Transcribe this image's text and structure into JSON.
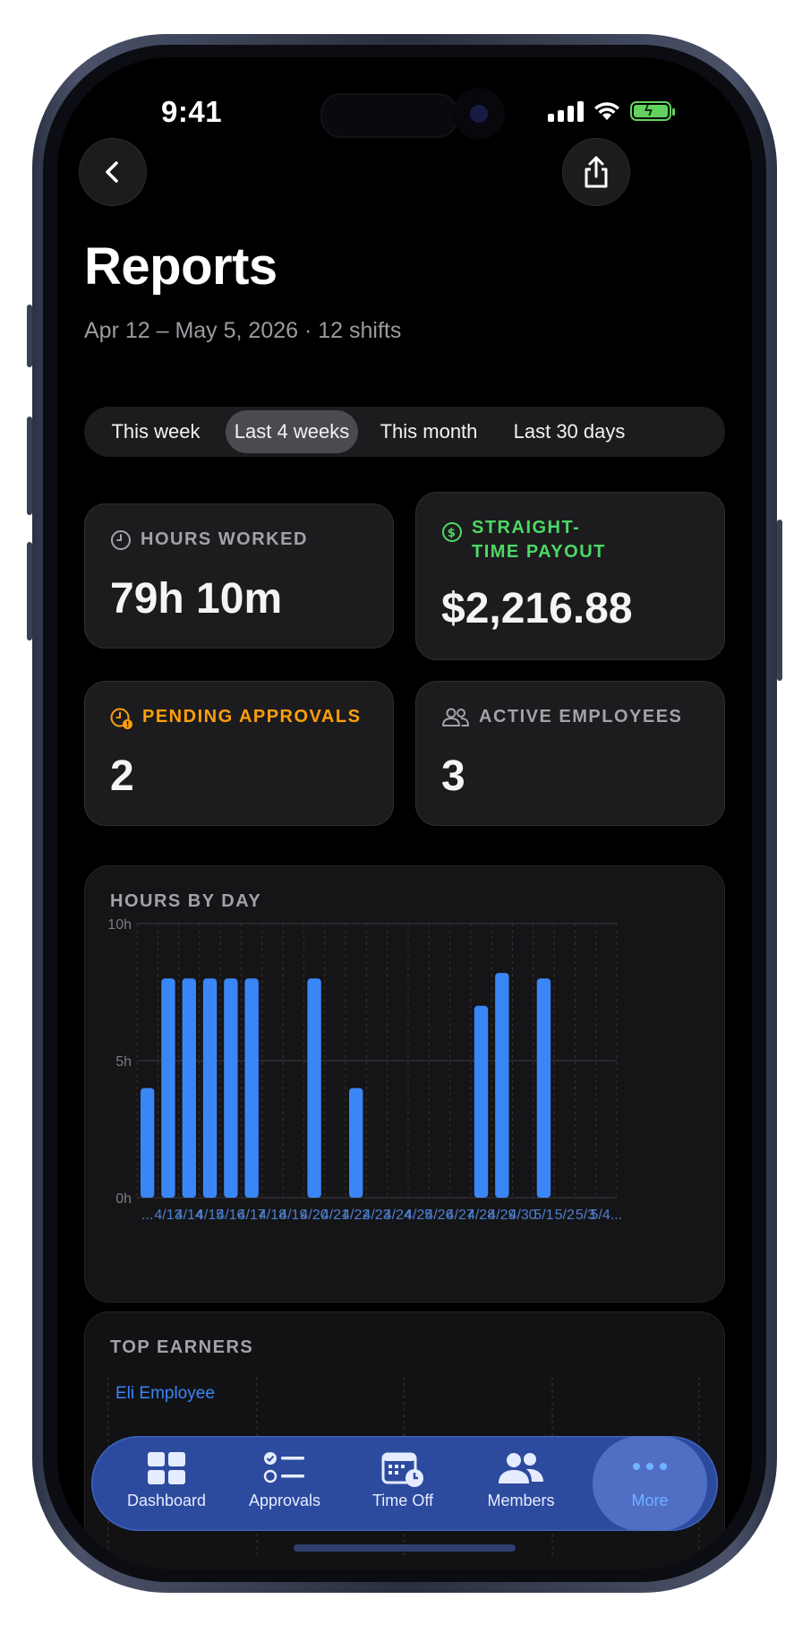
{
  "status_bar": {
    "time": "9:41"
  },
  "header": {
    "title": "Reports",
    "subtitle": "Apr 12 – May 5, 2026 · 12 shifts"
  },
  "range_tabs": [
    {
      "label": "This week",
      "active": false
    },
    {
      "label": "Last 4 weeks",
      "active": true
    },
    {
      "label": "This month",
      "active": false
    },
    {
      "label": "Last 30 days",
      "active": false
    }
  ],
  "stats": {
    "hours": {
      "label": "HOURS WORKED",
      "value": "79h 10m",
      "icon": "clock-icon"
    },
    "payout": {
      "label_line1": "STRAIGHT-",
      "label_line2": "TIME PAYOUT",
      "value": "$2,216.88",
      "icon": "dollar-circle-icon",
      "color": "#4cd964"
    },
    "pending": {
      "label": "PENDING APPROVALS",
      "value": "2",
      "icon": "clock-alert-icon",
      "color": "#ff9f0a"
    },
    "employees": {
      "label": "ACTIVE EMPLOYEES",
      "value": "3",
      "icon": "people-icon"
    }
  },
  "chart_section": {
    "title": "HOURS BY DAY"
  },
  "chart_data": {
    "type": "bar",
    "title": "HOURS BY DAY",
    "y_ticks": [
      "10h",
      "5h",
      "0h"
    ],
    "ylim": [
      0,
      10
    ],
    "bar_color": "#3a86f7",
    "grid": true,
    "categories": [
      "...",
      "4/13",
      "4/14",
      "4/15",
      "4/16",
      "4/17",
      "4/18",
      "4/19",
      "4/20",
      "4/21",
      "4/22",
      "4/23",
      "4/24",
      "4/25",
      "4/26",
      "4/27",
      "4/28",
      "4/29",
      "4/30",
      "5/1",
      "5/2",
      "5/3",
      "5/4..."
    ],
    "values": [
      4,
      8,
      8,
      8,
      8,
      8,
      0,
      0,
      8,
      0,
      4,
      0,
      0,
      0,
      0,
      0,
      7,
      8.2,
      0,
      8,
      0,
      0,
      0
    ]
  },
  "top_earners": {
    "title": "TOP EARNERS",
    "first_name": "Eli Employee",
    "name_color": "#3a86f7"
  },
  "tab_bar": [
    {
      "label": "Dashboard",
      "icon": "dashboard-grid-icon"
    },
    {
      "label": "Approvals",
      "icon": "checklist-icon"
    },
    {
      "label": "Time Off",
      "icon": "calendar-clock-icon"
    },
    {
      "label": "Members",
      "icon": "people-icon"
    },
    {
      "label": "More",
      "icon": "ellipsis-icon",
      "active": true
    }
  ]
}
